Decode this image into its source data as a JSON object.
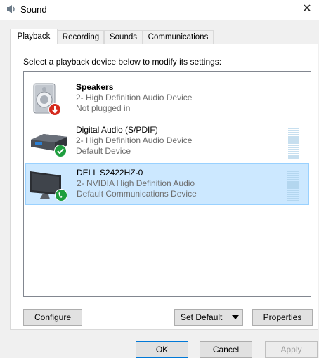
{
  "window": {
    "title": "Sound",
    "close_glyph": "✕"
  },
  "tabs": [
    {
      "label": "Playback",
      "active": true
    },
    {
      "label": "Recording",
      "active": false
    },
    {
      "label": "Sounds",
      "active": false
    },
    {
      "label": "Communications",
      "active": false
    }
  ],
  "instruction": "Select a playback device below to modify its settings:",
  "devices": [
    {
      "name": "Speakers",
      "description": "2- High Definition Audio Device",
      "status": "Not plugged in",
      "icon": "speaker-icon",
      "badge": "unplugged-badge-icon",
      "selected": false,
      "has_meter": false
    },
    {
      "name": "Digital Audio (S/PDIF)",
      "description": "2- High Definition Audio Device",
      "status": "Default Device",
      "icon": "spdif-device-icon",
      "badge": "default-check-badge-icon",
      "selected": false,
      "has_meter": true
    },
    {
      "name": "DELL S2422HZ-0",
      "description": "2- NVIDIA High Definition Audio",
      "status": "Default Communications Device",
      "icon": "monitor-icon",
      "badge": "communications-phone-badge-icon",
      "selected": true,
      "has_meter": true
    }
  ],
  "buttons": {
    "configure": "Configure",
    "set_default": "Set Default",
    "properties": "Properties",
    "ok": "OK",
    "cancel": "Cancel",
    "apply": "Apply"
  },
  "colors": {
    "selection_bg": "#cce8ff",
    "selection_border": "#99d1ff",
    "accent": "#0078d7",
    "badge_green": "#1e9e3e",
    "badge_red": "#d52b1e"
  }
}
